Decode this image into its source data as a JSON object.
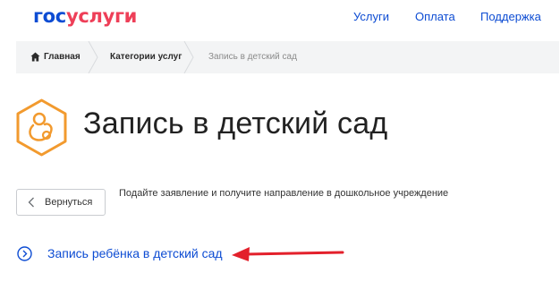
{
  "header": {
    "logo": {
      "part1": "гос",
      "part2": "услуги"
    },
    "nav": [
      {
        "label": "Услуги"
      },
      {
        "label": "Оплата"
      },
      {
        "label": "Поддержка"
      }
    ]
  },
  "breadcrumb": [
    {
      "label": "Главная"
    },
    {
      "label": "Категории услуг"
    },
    {
      "label": "Запись в детский сад"
    }
  ],
  "page": {
    "title": "Запись в детский сад",
    "back_label": "Вернуться",
    "description": "Подайте заявление и получите направление в дошкольное учреждение",
    "action_link": "Запись ребёнка в детский сад"
  },
  "icons": {
    "service": "pacifier-hexagon-icon",
    "home": "home-icon",
    "back": "chevron-left-icon",
    "action": "chevron-right-circle-icon",
    "annotation": "red-arrow-left-icon"
  },
  "colors": {
    "brand_blue": "#0d4cd3",
    "brand_red": "#ee3f58",
    "icon_orange": "#f29a2e",
    "arrow_red": "#e3202b",
    "breadcrumb_bg": "#f3f4f5"
  }
}
